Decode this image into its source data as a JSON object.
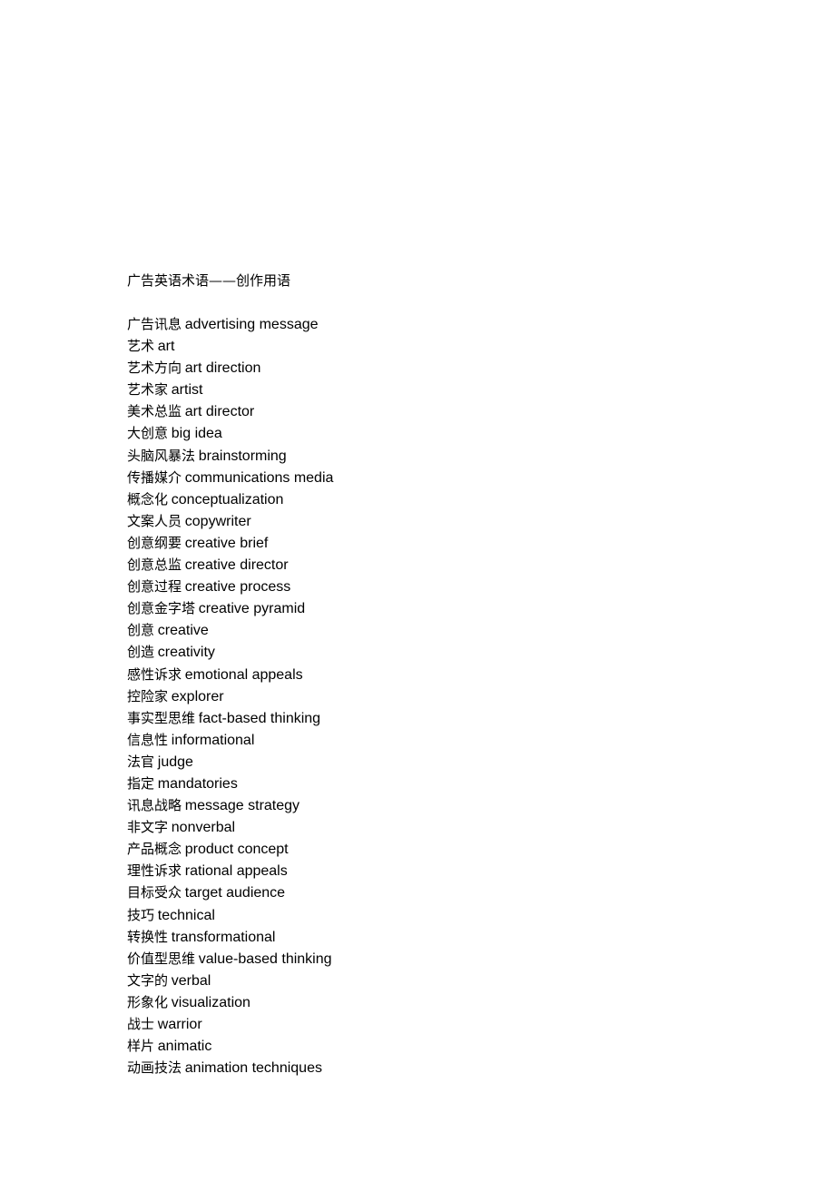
{
  "document": {
    "title": "广告英语术语——创作用语",
    "terms": [
      {
        "zh": "广告讯息",
        "en": "advertising message"
      },
      {
        "zh": "艺术",
        "en": "art"
      },
      {
        "zh": "艺术方向",
        "en": "art direction"
      },
      {
        "zh": "艺术家",
        "en": "artist"
      },
      {
        "zh": "美术总监",
        "en": "art director"
      },
      {
        "zh": "大创意",
        "en": "big idea"
      },
      {
        "zh": "头脑风暴法",
        "en": "brainstorming"
      },
      {
        "zh": "传播媒介",
        "en": "communications media"
      },
      {
        "zh": "概念化",
        "en": "conceptualization"
      },
      {
        "zh": "文案人员",
        "en": "copywriter"
      },
      {
        "zh": "创意纲要",
        "en": "creative brief"
      },
      {
        "zh": "创意总监",
        "en": "creative director"
      },
      {
        "zh": "创意过程",
        "en": "creative process"
      },
      {
        "zh": "创意金字塔",
        "en": "creative pyramid"
      },
      {
        "zh": "创意",
        "en": "creative"
      },
      {
        "zh": "创造",
        "en": "creativity"
      },
      {
        "zh": "感性诉求",
        "en": "emotional appeals"
      },
      {
        "zh": "控险家",
        "en": "explorer"
      },
      {
        "zh": "事实型思维",
        "en": "fact-based thinking"
      },
      {
        "zh": "信息性",
        "en": "informational"
      },
      {
        "zh": "法官",
        "en": "judge"
      },
      {
        "zh": "指定",
        "en": "mandatories"
      },
      {
        "zh": "讯息战略",
        "en": "message strategy"
      },
      {
        "zh": "非文字",
        "en": "nonverbal"
      },
      {
        "zh": "产品概念",
        "en": "product concept"
      },
      {
        "zh": "理性诉求",
        "en": "rational appeals"
      },
      {
        "zh": "目标受众",
        "en": "target audience"
      },
      {
        "zh": "技巧",
        "en": "technical"
      },
      {
        "zh": "转换性",
        "en": "transformational"
      },
      {
        "zh": "价值型思维",
        "en": "value-based thinking"
      },
      {
        "zh": "文字的",
        "en": "verbal"
      },
      {
        "zh": "形象化",
        "en": "visualization"
      },
      {
        "zh": "战士",
        "en": "warrior"
      },
      {
        "zh": "样片",
        "en": "animatic"
      },
      {
        "zh": "动画技法",
        "en": "animation techniques"
      }
    ]
  }
}
